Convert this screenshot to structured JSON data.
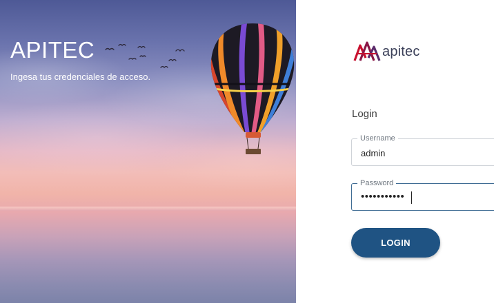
{
  "hero": {
    "title": "APITEC",
    "subtitle": "Ingesa tus credenciales de acceso."
  },
  "brand": {
    "logo_icon": "apitec-a-logo",
    "logo_text": "apitec",
    "colors": {
      "logo_red": "#c8102e",
      "logo_purple": "#5b2a6a",
      "text": "#3a3f58"
    }
  },
  "login": {
    "heading": "Login",
    "username": {
      "label": "Username",
      "value": "admin"
    },
    "password": {
      "label": "Password",
      "value": "•••••••••••"
    },
    "button_label": "LOGIN",
    "button_color": "#1f5383"
  }
}
